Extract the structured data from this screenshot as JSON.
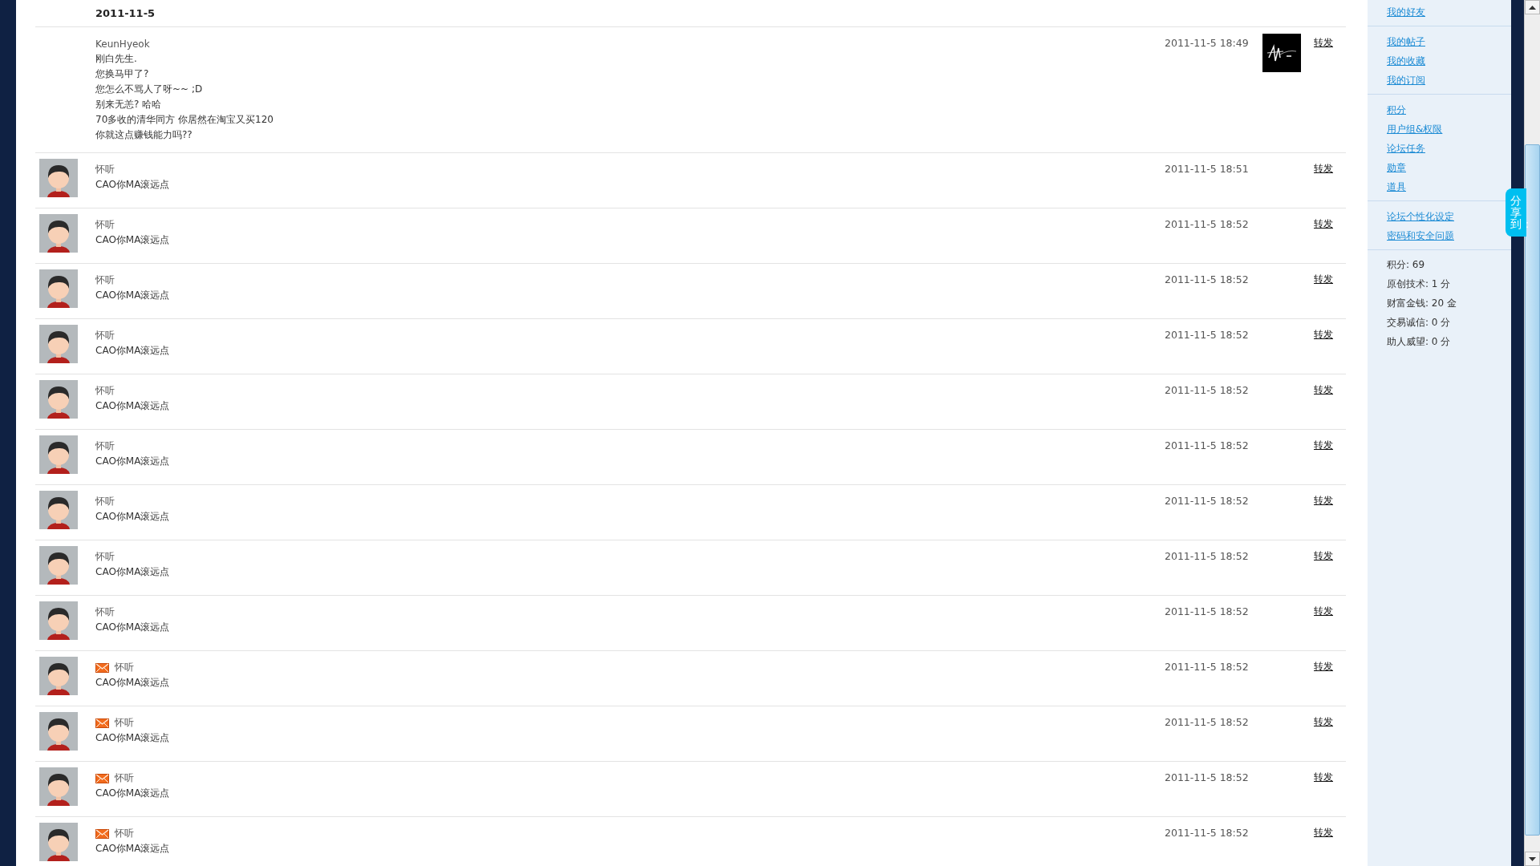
{
  "date_header": "2011-11-5",
  "messages": [
    {
      "kind": "picture",
      "mail": false,
      "author": "KeunHyeok",
      "lines": [
        "刚白先生.",
        "您换马甲了?",
        "您怎么不骂人了呀~~ ;D",
        "别来无恙? 哈哈",
        "70多收的清华同方 你居然在淘宝又买120",
        "你就这点赚钱能力吗??"
      ],
      "time": "2011-11-5 18:49",
      "action": "转发"
    },
    {
      "kind": "figure",
      "mail": false,
      "author": "怀听",
      "lines": [
        "CAO你MA滚远点"
      ],
      "time": "2011-11-5 18:51",
      "action": "转发"
    },
    {
      "kind": "figure",
      "mail": false,
      "author": "怀听",
      "lines": [
        "CAO你MA滚远点"
      ],
      "time": "2011-11-5 18:52",
      "action": "转发"
    },
    {
      "kind": "figure",
      "mail": false,
      "author": "怀听",
      "lines": [
        "CAO你MA滚远点"
      ],
      "time": "2011-11-5 18:52",
      "action": "转发"
    },
    {
      "kind": "figure",
      "mail": false,
      "author": "怀听",
      "lines": [
        "CAO你MA滚远点"
      ],
      "time": "2011-11-5 18:52",
      "action": "转发"
    },
    {
      "kind": "figure",
      "mail": false,
      "author": "怀听",
      "lines": [
        "CAO你MA滚远点"
      ],
      "time": "2011-11-5 18:52",
      "action": "转发"
    },
    {
      "kind": "figure",
      "mail": false,
      "author": "怀听",
      "lines": [
        "CAO你MA滚远点"
      ],
      "time": "2011-11-5 18:52",
      "action": "转发"
    },
    {
      "kind": "figure",
      "mail": false,
      "author": "怀听",
      "lines": [
        "CAO你MA滚远点"
      ],
      "time": "2011-11-5 18:52",
      "action": "转发"
    },
    {
      "kind": "figure",
      "mail": false,
      "author": "怀听",
      "lines": [
        "CAO你MA滚远点"
      ],
      "time": "2011-11-5 18:52",
      "action": "转发"
    },
    {
      "kind": "figure",
      "mail": false,
      "author": "怀听",
      "lines": [
        "CAO你MA滚远点"
      ],
      "time": "2011-11-5 18:52",
      "action": "转发"
    },
    {
      "kind": "figure",
      "mail": true,
      "author": "怀听",
      "lines": [
        "CAO你MA滚远点"
      ],
      "time": "2011-11-5 18:52",
      "action": "转发"
    },
    {
      "kind": "figure",
      "mail": true,
      "author": "怀听",
      "lines": [
        "CAO你MA滚远点"
      ],
      "time": "2011-11-5 18:52",
      "action": "转发"
    },
    {
      "kind": "figure",
      "mail": true,
      "author": "怀听",
      "lines": [
        "CAO你MA滚远点"
      ],
      "time": "2011-11-5 18:52",
      "action": "转发"
    },
    {
      "kind": "figure",
      "mail": true,
      "author": "怀听",
      "lines": [
        "CAO你MA滚远点"
      ],
      "time": "2011-11-5 18:52",
      "action": "转发"
    }
  ],
  "sidebar": {
    "link_groups": [
      [
        "我的好友"
      ],
      [
        "我的帖子",
        "我的收藏",
        "我的订阅"
      ],
      [
        "积分",
        "用户组&权限",
        "论坛任务",
        "勋章",
        "道具"
      ],
      [
        "论坛个性化设定",
        "密码和安全问题"
      ]
    ],
    "stats": [
      "积分: 69",
      "原创技术: 1 分",
      "财富金钱: 20 金",
      "交易诚信: 0 分",
      "助人威望: 0 分"
    ]
  },
  "share_tab": "分享到："
}
